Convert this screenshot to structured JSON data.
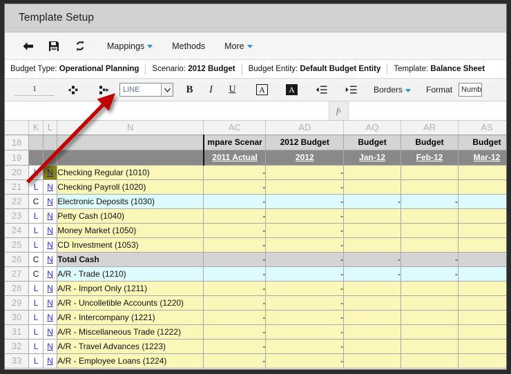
{
  "window": {
    "title": "Template Setup"
  },
  "main_toolbar": {
    "icons": [
      {
        "name": "back-arrow-icon",
        "label": "Back"
      },
      {
        "name": "save-icon",
        "label": "Save"
      },
      {
        "name": "refresh-icon",
        "label": "Refresh"
      }
    ],
    "menus": [
      {
        "label": "Mappings",
        "has_caret": true
      },
      {
        "label": "Methods",
        "has_caret": false
      },
      {
        "label": "More",
        "has_caret": true
      }
    ]
  },
  "context_bar": [
    {
      "label": "Budget Type:",
      "value": "Operational Planning"
    },
    {
      "label": "Scenario:",
      "value": "2012 Budget"
    },
    {
      "label": "Budget Entity:",
      "value": "Default Budget Entity"
    },
    {
      "label": "Template:",
      "value": "Balance Sheet"
    }
  ],
  "format_toolbar": {
    "cell_ref": "1",
    "outdent_icon": "decrease-list-level-icon",
    "indent_icon": "increase-list-level-icon",
    "style_select": {
      "value": "LINE",
      "options": [
        "LINE"
      ]
    },
    "bold_label": "B",
    "italic_label": "I",
    "underline_label": "U",
    "font_color_label": "A",
    "fill_color_label": "A",
    "decrease_indent_icon": "decrease-indent-icon",
    "increase_indent_icon": "increase-indent-icon",
    "borders_label": "Borders",
    "format_label": "Format",
    "number_format": {
      "value": "Number"
    }
  },
  "formula_bar": {
    "fx_label": "fx",
    "value": "",
    "placeholder": ""
  },
  "sheet": {
    "column_headers": [
      "",
      "K",
      "L",
      "N",
      "AC",
      "AD",
      "AQ",
      "AR",
      "AS"
    ],
    "header_rows": [
      {
        "row_number": "18",
        "cells": [
          "",
          "",
          "",
          "mpare Scenar",
          "2012 Budget",
          "Budget",
          "Budget",
          "Budget"
        ]
      },
      {
        "row_number": "19",
        "cells": [
          "",
          "",
          "",
          "2011 Actual",
          "2012",
          "Jan-12",
          "Feb-12",
          "Mar-12"
        ]
      }
    ],
    "rows": [
      {
        "num": "20",
        "k": "L",
        "l": "N",
        "label": "Checking Regular (1010)",
        "fill": "yellow",
        "bold": false,
        "selected": true,
        "values": [
          "-",
          "-",
          "",
          "",
          ""
        ]
      },
      {
        "num": "21",
        "k": "L",
        "l": "N",
        "label": "Checking Payroll (1020)",
        "fill": "yellow",
        "bold": false,
        "selected": false,
        "values": [
          "-",
          "-",
          "",
          "",
          ""
        ]
      },
      {
        "num": "22",
        "k": "C",
        "l": "N",
        "label": "Electronic Deposits (1030)",
        "fill": "cyan",
        "bold": false,
        "selected": false,
        "values": [
          "-",
          "-",
          "-",
          "-",
          "-"
        ]
      },
      {
        "num": "23",
        "k": "L",
        "l": "N",
        "label": "Petty Cash (1040)",
        "fill": "yellow",
        "bold": false,
        "selected": false,
        "values": [
          "-",
          "-",
          "",
          "",
          ""
        ]
      },
      {
        "num": "24",
        "k": "L",
        "l": "N",
        "label": "Money Market (1050)",
        "fill": "yellow",
        "bold": false,
        "selected": false,
        "values": [
          "-",
          "-",
          "",
          "",
          ""
        ]
      },
      {
        "num": "25",
        "k": "L",
        "l": "N",
        "label": "CD Investment (1053)",
        "fill": "yellow",
        "bold": false,
        "selected": false,
        "values": [
          "-",
          "-",
          "",
          "",
          ""
        ]
      },
      {
        "num": "26",
        "k": "C",
        "l": "N",
        "label": "Total Cash",
        "fill": "grey",
        "bold": true,
        "selected": false,
        "values": [
          "-",
          "-",
          "-",
          "-",
          "-"
        ]
      },
      {
        "num": "27",
        "k": "C",
        "l": "N",
        "label": "A/R - Trade (1210)",
        "fill": "cyan",
        "bold": false,
        "selected": false,
        "values": [
          "-",
          "-",
          "-",
          "-",
          "-"
        ]
      },
      {
        "num": "28",
        "k": "L",
        "l": "N",
        "label": "A/R - Import Only (1211)",
        "fill": "yellow",
        "bold": false,
        "selected": false,
        "values": [
          "-",
          "-",
          "",
          "",
          ""
        ]
      },
      {
        "num": "29",
        "k": "L",
        "l": "N",
        "label": "A/R - Uncolletible Accounts (1220)",
        "fill": "yellow",
        "bold": false,
        "selected": false,
        "values": [
          "-",
          "-",
          "",
          "",
          ""
        ]
      },
      {
        "num": "30",
        "k": "L",
        "l": "N",
        "label": "A/R - Intercompany (1221)",
        "fill": "yellow",
        "bold": false,
        "selected": false,
        "values": [
          "-",
          "-",
          "",
          "",
          ""
        ]
      },
      {
        "num": "31",
        "k": "L",
        "l": "N",
        "label": "A/R - Miscellaneous Trade (1222)",
        "fill": "yellow",
        "bold": false,
        "selected": false,
        "values": [
          "-",
          "-",
          "",
          "",
          ""
        ]
      },
      {
        "num": "32",
        "k": "L",
        "l": "N",
        "label": "A/R - Travel Advances (1223)",
        "fill": "yellow",
        "bold": false,
        "selected": false,
        "values": [
          "-",
          "-",
          "",
          "",
          ""
        ]
      },
      {
        "num": "33",
        "k": "L",
        "l": "N",
        "label": "A/R - Employee Loans (1224)",
        "fill": "yellow",
        "bold": false,
        "selected": false,
        "values": [
          "-",
          "-",
          "",
          "",
          ""
        ]
      }
    ]
  },
  "annotation": {
    "type": "arrow",
    "color": "#c00000",
    "points_to": "style-select-dropdown"
  },
  "colors": {
    "titlebar": "#d2d2d2",
    "toolbar": "#f5f5f5",
    "row_yellow": "#fbf7b8",
    "row_cyan": "#ddfbff",
    "row_grey": "#d4d4d4",
    "header_grey": "#898989",
    "selection": "#85801a",
    "link_blue": "#2b2bd0",
    "caret_blue": "#2196d8",
    "arrow_red": "#c00000"
  }
}
